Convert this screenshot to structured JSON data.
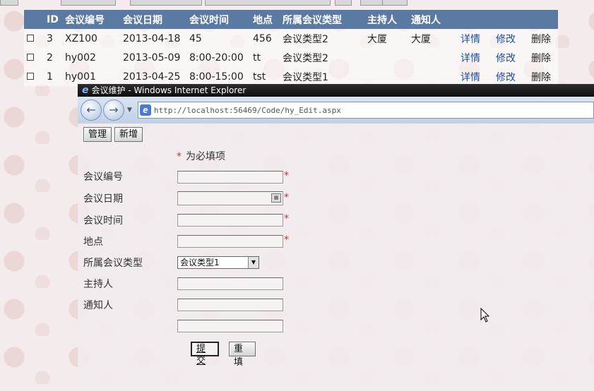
{
  "table": {
    "headers": [
      "ID",
      "会议编号",
      "会议日期",
      "会议时间",
      "地点",
      "所属会议类型",
      "主持人",
      "通知人"
    ],
    "rows": [
      {
        "id": "3",
        "code": "XZ100",
        "date": "2013-04-18",
        "time": "45",
        "place": "456",
        "type": "会议类型2",
        "host": "大厦",
        "notify": "大厦",
        "detail": "详情",
        "edit": "修改",
        "delete": "删除"
      },
      {
        "id": "2",
        "code": "hy002",
        "date": "2013-05-09",
        "time": "8:00-20:00",
        "place": "tt",
        "type": "会议类型2",
        "host": "",
        "notify": "",
        "detail": "详情",
        "edit": "修改",
        "delete": "删除"
      },
      {
        "id": "1",
        "code": "hy001",
        "date": "2013-04-25",
        "time": "8:00-15:00",
        "place": "tst",
        "type": "会议类型1",
        "host": "",
        "notify": "",
        "detail": "详情",
        "edit": "修改",
        "delete": "删除"
      }
    ]
  },
  "browser": {
    "title": "会议维护 - Windows Internet Explorer",
    "address": "http://localhost:56469/Code/hy_Edit.aspx",
    "back_icon": "back-arrow-icon",
    "forward_icon": "forward-arrow-icon"
  },
  "form": {
    "manage_label": "管理",
    "add_label": "新增",
    "star": "*",
    "required_note": "为必填项",
    "fields": {
      "code": "会议编号",
      "date": "会议日期",
      "time": "会议时间",
      "place": "地点",
      "type": "所属会议类型",
      "host": "主持人",
      "notify": "通知人"
    },
    "type_selected": "会议类型1",
    "submit_label": "提交",
    "reset_label": "重填"
  },
  "colors": {
    "header_bg": "#5a7aa4",
    "link": "#1d4ea0",
    "required": "#c33333",
    "ie_title_bg": "#111111"
  }
}
